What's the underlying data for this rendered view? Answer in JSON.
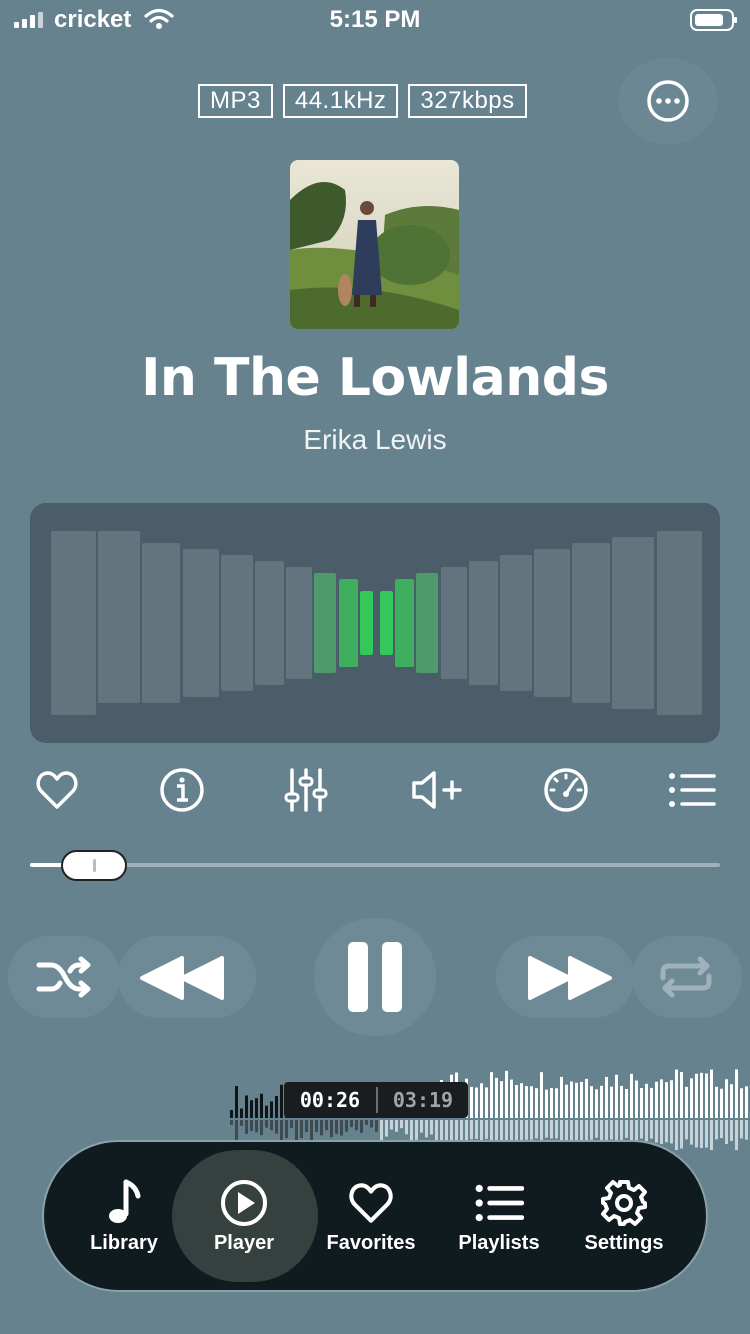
{
  "status_bar": {
    "carrier": "cricket",
    "time": "5:15 PM"
  },
  "format": {
    "codec": "MP3",
    "sample_rate": "44.1kHz",
    "bitrate": "327kbps"
  },
  "track": {
    "title": "In The Lowlands",
    "artist": "Erika Lewis"
  },
  "playback": {
    "elapsed": "00:26",
    "total": "03:19",
    "progress": 0.13,
    "state": "playing"
  },
  "colors": {
    "background": "#66828f",
    "visualizer_active": "#34c759",
    "tab_bar": "#101b1f"
  },
  "toolbar": [
    "heart-icon",
    "info-icon",
    "equalizer-icon",
    "volume-boost-icon",
    "speed-icon",
    "queue-list-icon"
  ],
  "tabs": [
    {
      "label": "Library",
      "icon": "music-note-icon"
    },
    {
      "label": "Player",
      "icon": "play-circle-icon",
      "active": true
    },
    {
      "label": "Favorites",
      "icon": "heart-icon"
    },
    {
      "label": "Playlists",
      "icon": "list-icon"
    },
    {
      "label": "Settings",
      "icon": "gear-icon"
    }
  ]
}
